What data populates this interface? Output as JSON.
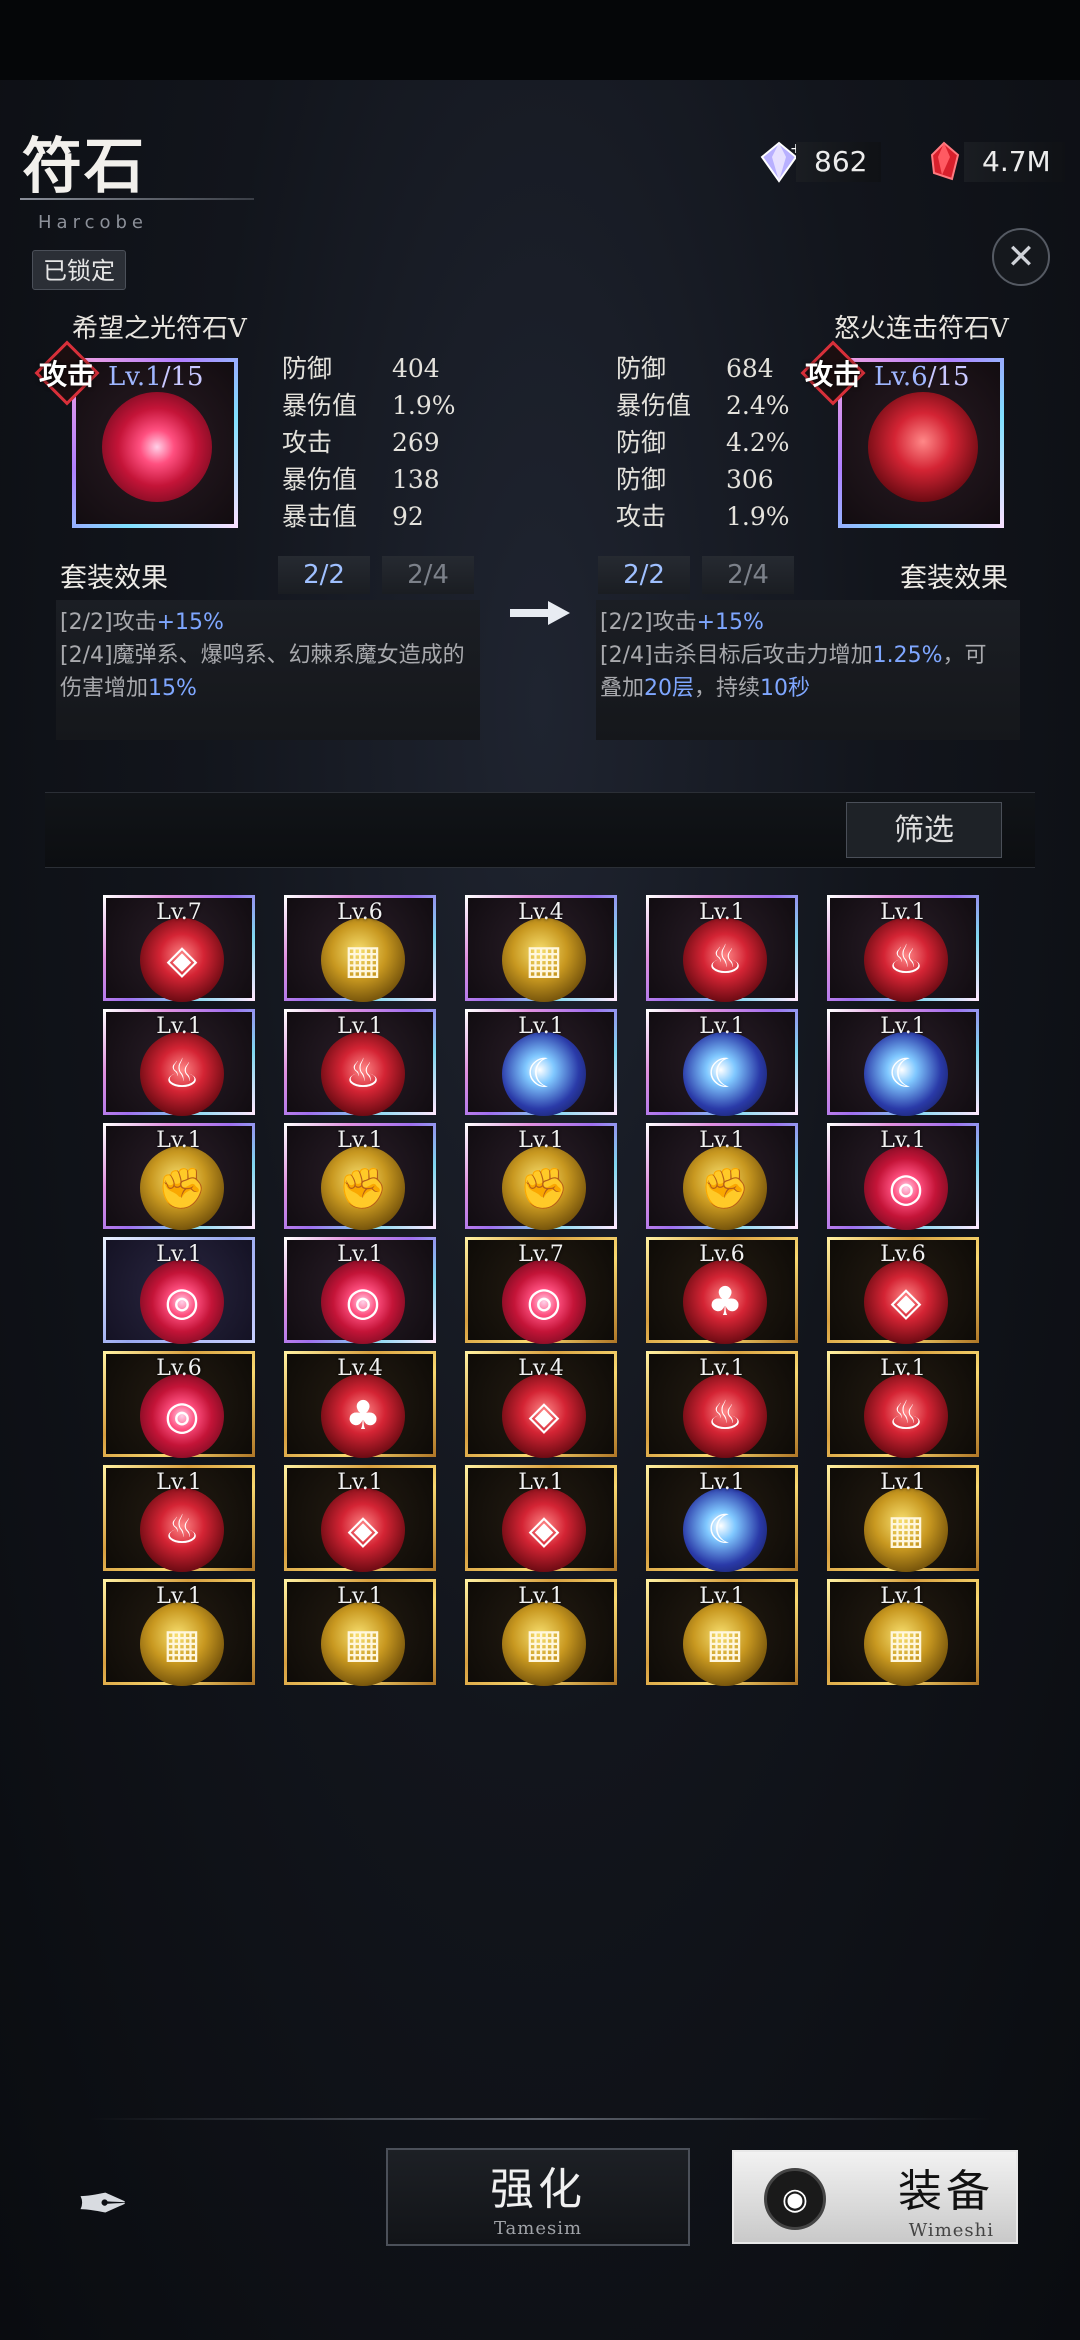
{
  "header": {
    "title": "符石",
    "subtitle": "Harcobe",
    "lock_label": "已锁定",
    "currency_gem": "862",
    "currency_crystal": "4.7M",
    "close_icon": "crossed-swords-icon"
  },
  "left_rune": {
    "name": "希望之光符石Ⅴ",
    "type_tag": "攻击",
    "level": "Lv.1",
    "level_max": "/15",
    "stats": [
      {
        "k": "防御",
        "v": "404"
      },
      {
        "k": "暴伤值",
        "v": "1.9%"
      },
      {
        "k": "攻击",
        "v": "269"
      },
      {
        "k": "暴伤值",
        "v": "138"
      },
      {
        "k": "暴击值",
        "v": "92"
      }
    ],
    "set_title": "套装效果",
    "tab1": "2/2",
    "tab2": "2/4",
    "set_line1_a": "[2/2]攻击",
    "set_line1_b": "+15%",
    "set_line2_a": "[2/4]魔弹系、爆鸣系、幻棘系魔女造成的",
    "set_line3_a": "伤害增加",
    "set_line3_b": "15%"
  },
  "right_rune": {
    "name": "怒火连击符石Ⅴ",
    "type_tag": "攻击",
    "level": "Lv.6",
    "level_max": "/15",
    "stats": [
      {
        "k": "防御",
        "v": "684"
      },
      {
        "k": "暴伤值",
        "v": "2.4%"
      },
      {
        "k": "防御",
        "v": "4.2%"
      },
      {
        "k": "防御",
        "v": "306"
      },
      {
        "k": "攻击",
        "v": "1.9%"
      }
    ],
    "set_title": "套装效果",
    "tab1": "2/2",
    "tab2": "2/4",
    "set_line1_a": "[2/2]攻击",
    "set_line1_b": "+15%",
    "set_line2_a": "[2/4]击杀目标后攻击力增加",
    "set_line2_b": "1.25%",
    "set_line2_c": "，可",
    "set_line3_a": "叠加",
    "set_line3_b": "20层",
    "set_line3_c": "，持续",
    "set_line3_d": "10秒"
  },
  "filter_label": "筛选",
  "grid": [
    [
      {
        "lv": "Lv.7",
        "frame": "purple",
        "orb": "red",
        "glyph": "◈"
      },
      {
        "lv": "Lv.6",
        "frame": "purple",
        "orb": "gold",
        "glyph": "▦"
      },
      {
        "lv": "Lv.4",
        "frame": "purple",
        "orb": "gold",
        "glyph": "▦"
      },
      {
        "lv": "Lv.1",
        "frame": "purple",
        "orb": "red",
        "glyph": "♨"
      },
      {
        "lv": "Lv.1",
        "frame": "purple",
        "orb": "red",
        "glyph": "♨"
      }
    ],
    [
      {
        "lv": "Lv.1",
        "frame": "purple",
        "orb": "red",
        "glyph": "♨"
      },
      {
        "lv": "Lv.1",
        "frame": "purple",
        "orb": "red",
        "glyph": "♨"
      },
      {
        "lv": "Lv.1",
        "frame": "purple",
        "orb": "blue",
        "glyph": "☾"
      },
      {
        "lv": "Lv.1",
        "frame": "purple",
        "orb": "blue",
        "glyph": "☾"
      },
      {
        "lv": "Lv.1",
        "frame": "purple",
        "orb": "blue",
        "glyph": "☾"
      }
    ],
    [
      {
        "lv": "Lv.1",
        "frame": "purple",
        "orb": "gold",
        "glyph": "✊"
      },
      {
        "lv": "Lv.1",
        "frame": "purple",
        "orb": "gold",
        "glyph": "✊"
      },
      {
        "lv": "Lv.1",
        "frame": "purple",
        "orb": "gold",
        "glyph": "✊"
      },
      {
        "lv": "Lv.1",
        "frame": "purple",
        "orb": "gold",
        "glyph": "✊"
      },
      {
        "lv": "Lv.1",
        "frame": "purple",
        "orb": "pink",
        "glyph": "◎"
      }
    ],
    [
      {
        "lv": "Lv.1",
        "frame": "blue",
        "orb": "pink",
        "glyph": "◎"
      },
      {
        "lv": "Lv.1",
        "frame": "purple",
        "orb": "pink",
        "glyph": "◎"
      },
      {
        "lv": "Lv.7",
        "frame": "gold",
        "orb": "pink",
        "glyph": "◎"
      },
      {
        "lv": "Lv.6",
        "frame": "gold",
        "orb": "red",
        "glyph": "♣"
      },
      {
        "lv": "Lv.6",
        "frame": "gold",
        "orb": "red",
        "glyph": "◈"
      }
    ],
    [
      {
        "lv": "Lv.6",
        "frame": "gold",
        "orb": "pink",
        "glyph": "◎"
      },
      {
        "lv": "Lv.4",
        "frame": "gold",
        "orb": "red",
        "glyph": "♣"
      },
      {
        "lv": "Lv.4",
        "frame": "gold",
        "orb": "red",
        "glyph": "◈"
      },
      {
        "lv": "Lv.1",
        "frame": "gold",
        "orb": "red",
        "glyph": "♨"
      },
      {
        "lv": "Lv.1",
        "frame": "gold",
        "orb": "red",
        "glyph": "♨"
      }
    ],
    [
      {
        "lv": "Lv.1",
        "frame": "gold",
        "orb": "red",
        "glyph": "♨"
      },
      {
        "lv": "Lv.1",
        "frame": "gold",
        "orb": "red",
        "glyph": "◈"
      },
      {
        "lv": "Lv.1",
        "frame": "gold",
        "orb": "red",
        "glyph": "◈"
      },
      {
        "lv": "Lv.1",
        "frame": "gold",
        "orb": "blue",
        "glyph": "☾"
      },
      {
        "lv": "Lv.1",
        "frame": "gold",
        "orb": "gold",
        "glyph": "▦"
      }
    ],
    [
      {
        "lv": "Lv.1",
        "frame": "gold",
        "orb": "gold",
        "glyph": "▦"
      },
      {
        "lv": "Lv.1",
        "frame": "gold",
        "orb": "gold",
        "glyph": "▦"
      },
      {
        "lv": "Lv.1",
        "frame": "gold",
        "orb": "gold",
        "glyph": "▦"
      },
      {
        "lv": "Lv.1",
        "frame": "gold",
        "orb": "gold",
        "glyph": "▦"
      },
      {
        "lv": "Lv.1",
        "frame": "gold",
        "orb": "gold",
        "glyph": "▦"
      }
    ]
  ],
  "bottom": {
    "enhance_label": "强化",
    "enhance_sub": "Tamesim",
    "equip_label": "装备",
    "equip_sub": "Wimeshi",
    "equip_icon": "eye-emblem-icon",
    "back_icon": "quill-back-icon"
  }
}
